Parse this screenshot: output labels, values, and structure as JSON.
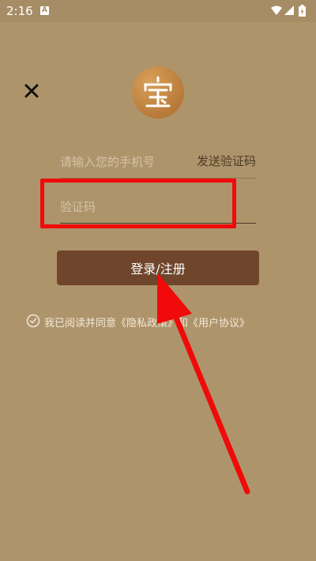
{
  "status_bar": {
    "time": "2:16",
    "notification_letter": "A"
  },
  "logo": {
    "character": "宝"
  },
  "form": {
    "phone_placeholder": "请输入您的手机号",
    "send_code_label": "发送验证码",
    "code_placeholder": "验证码",
    "login_label": "登录/注册"
  },
  "agreement": {
    "prefix": "我已阅读并同意",
    "privacy_link": "《隐私政策》",
    "conjunction": "和",
    "terms_link": "《用户协议》"
  },
  "colors": {
    "background": "#ae946b",
    "button": "#6f462c",
    "annotation_red": "#f00a0a",
    "logo_gold": "#c08540"
  },
  "icons": [
    "close-icon",
    "check-circle-icon",
    "wifi-icon",
    "signal-icon",
    "battery-icon"
  ]
}
